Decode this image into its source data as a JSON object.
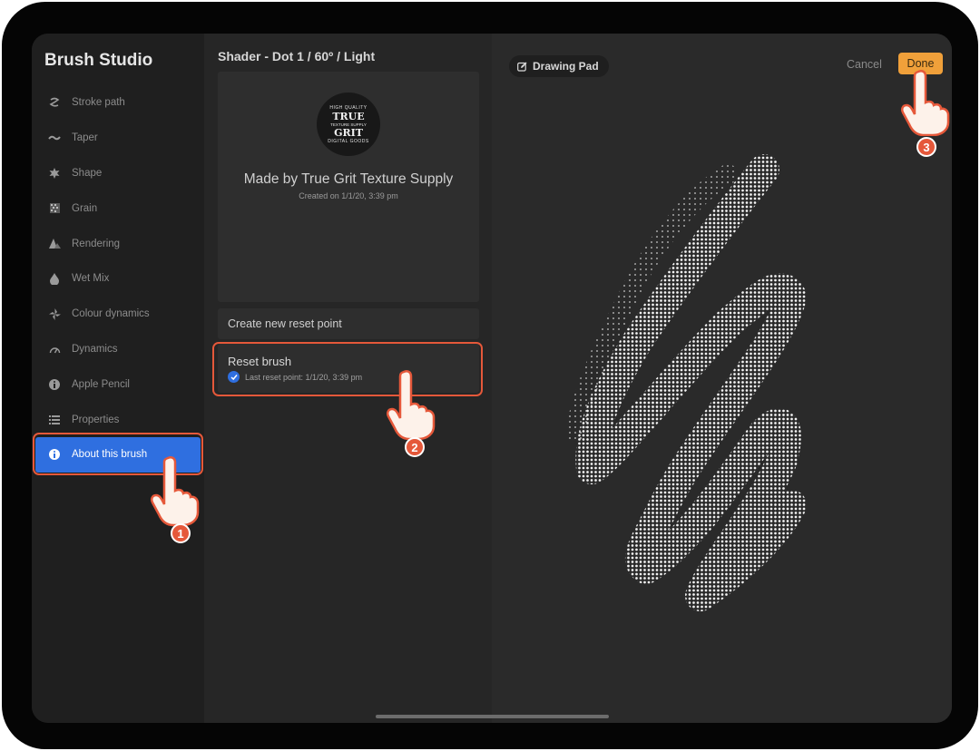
{
  "sidebar": {
    "title": "Brush Studio",
    "items": [
      {
        "label": "Stroke path",
        "icon": "stroke-path-icon"
      },
      {
        "label": "Taper",
        "icon": "taper-icon"
      },
      {
        "label": "Shape",
        "icon": "shape-icon"
      },
      {
        "label": "Grain",
        "icon": "grain-icon"
      },
      {
        "label": "Rendering",
        "icon": "rendering-icon"
      },
      {
        "label": "Wet Mix",
        "icon": "wet-mix-icon"
      },
      {
        "label": "Colour dynamics",
        "icon": "colour-dynamics-icon"
      },
      {
        "label": "Dynamics",
        "icon": "dynamics-icon"
      },
      {
        "label": "Apple Pencil",
        "icon": "apple-pencil-icon"
      },
      {
        "label": "Properties",
        "icon": "properties-icon"
      },
      {
        "label": "About this brush",
        "icon": "info-icon",
        "active": true
      }
    ]
  },
  "about": {
    "brush_name": "Shader - Dot  1 / 60º / Light",
    "logo": {
      "line1": "HIGH QUALITY",
      "line2": "TRUE",
      "line3": "TEXTURE SUPPLY",
      "line4": "GRIT",
      "line5": "DIGITAL GOODS"
    },
    "made_by": "Made by True Grit Texture Supply",
    "created": "Created on 1/1/20, 3:39 pm",
    "create_reset": "Create new reset point",
    "reset_brush": "Reset brush",
    "last_reset": "Last reset point: 1/1/20, 3:39 pm"
  },
  "canvas": {
    "drawing_pad": "Drawing Pad",
    "cancel": "Cancel",
    "done": "Done"
  },
  "steps": [
    "1",
    "2",
    "3"
  ],
  "colors": {
    "accent": "#2f6fe0",
    "done": "#f0a03a",
    "highlight": "#e5583a"
  }
}
